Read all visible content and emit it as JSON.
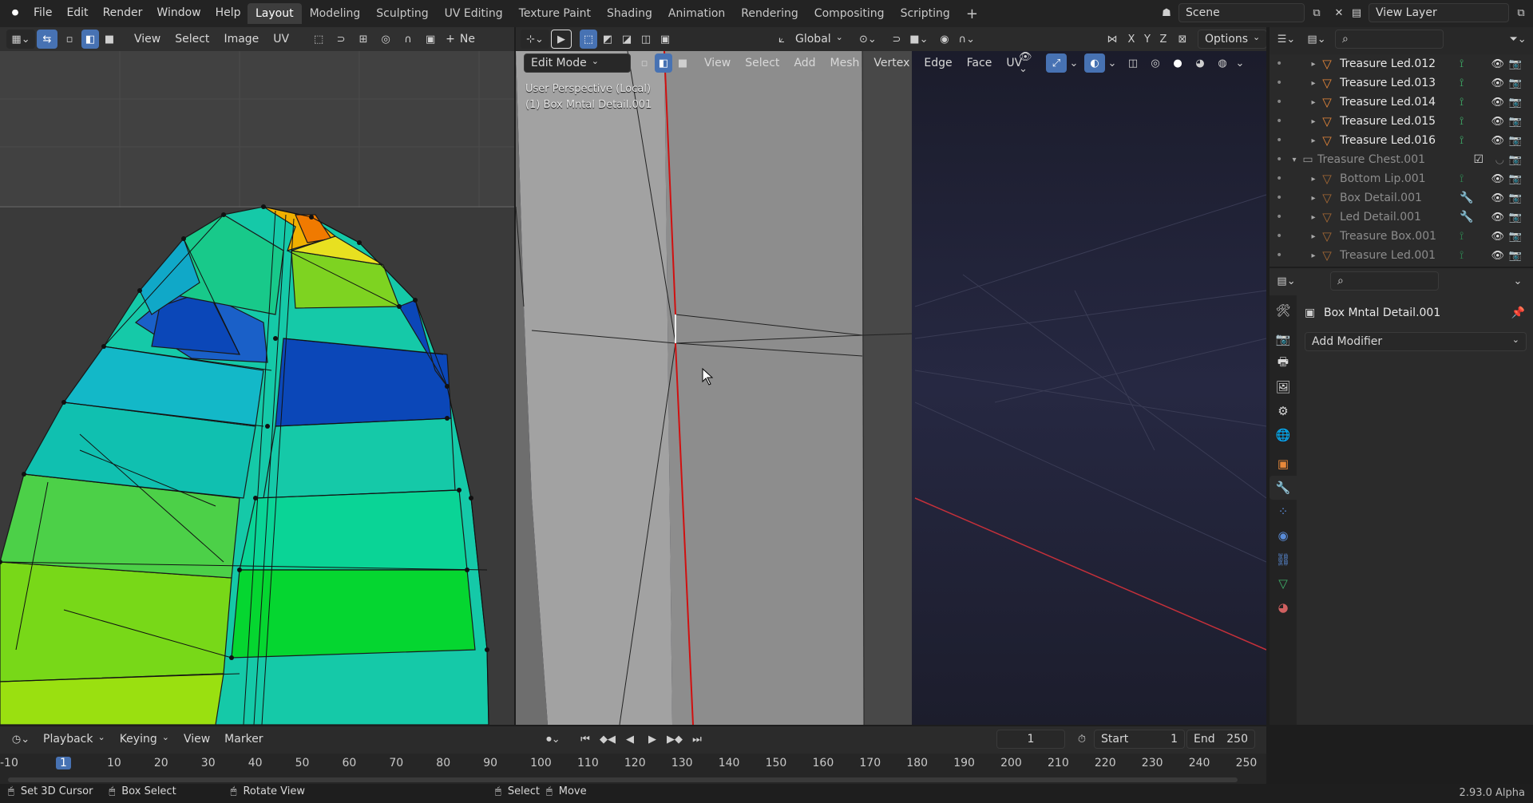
{
  "app": {
    "version": "2.93.0 Alpha"
  },
  "menu": [
    "File",
    "Edit",
    "Render",
    "Window",
    "Help"
  ],
  "workspaces": [
    "Layout",
    "Modeling",
    "Sculpting",
    "UV Editing",
    "Texture Paint",
    "Shading",
    "Animation",
    "Rendering",
    "Compositing",
    "Scripting"
  ],
  "active_workspace": "Layout",
  "scene": {
    "name": "Scene",
    "view_layer": "View Layer"
  },
  "uv_editor": {
    "menus": [
      "View",
      "Select",
      "Image",
      "UV"
    ],
    "new_label": "Ne"
  },
  "viewport": {
    "transform_orientation": "Global",
    "axes": [
      "X",
      "Y",
      "Z"
    ],
    "options_label": "Options",
    "mode": "Edit Mode",
    "menus": [
      "View",
      "Select",
      "Add",
      "Mesh",
      "Vertex",
      "Edge",
      "Face",
      "UV"
    ],
    "overlay_line1": "User Perspective (Local)",
    "overlay_line2": "(1) Box Mntal Detail.001"
  },
  "outliner": {
    "items": [
      {
        "label": "Treasure Led.012",
        "dim": false
      },
      {
        "label": "Treasure Led.013",
        "dim": false
      },
      {
        "label": "Treasure Led.014",
        "dim": false
      },
      {
        "label": "Treasure Led.015",
        "dim": false
      },
      {
        "label": "Treasure Led.016",
        "dim": false
      }
    ],
    "collection": "Treasure Chest.001",
    "children": [
      {
        "label": "Bottom Lip.001"
      },
      {
        "label": "Box Detail.001"
      },
      {
        "label": "Led Detail.001"
      },
      {
        "label": "Treasure Box.001"
      },
      {
        "label": "Treasure Led.001"
      }
    ]
  },
  "properties": {
    "object_name": "Box Mntal Detail.001",
    "add_modifier": "Add Modifier"
  },
  "timeline": {
    "menus": [
      "Playback",
      "Keying",
      "View",
      "Marker"
    ],
    "current_frame": "1",
    "start_label": "Start",
    "start": "1",
    "end_label": "End",
    "end": "250",
    "ticks": [
      "-10",
      "1",
      "10",
      "20",
      "30",
      "40",
      "50",
      "60",
      "70",
      "80",
      "90",
      "100",
      "110",
      "120",
      "130",
      "140",
      "150",
      "160",
      "170",
      "180",
      "190",
      "200",
      "210",
      "220",
      "230",
      "240",
      "250"
    ]
  },
  "status": {
    "left1": "Set 3D Cursor",
    "left2": "Box Select",
    "left3": "Rotate View",
    "mid1": "Select",
    "mid2": "Move"
  },
  "colors": {
    "accent": "#4772b3",
    "mesh_icon": "#e8883a",
    "x_axis": "#c4303a"
  }
}
